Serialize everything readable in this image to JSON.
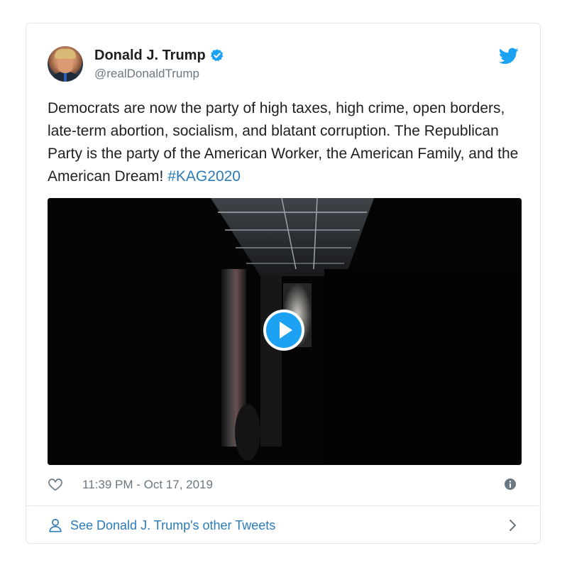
{
  "tweet": {
    "author_name": "Donald J. Trump",
    "handle": "@realDonaldTrump",
    "text": "Democrats are now the party of high taxes, high crime, open borders, late-term abortion, socialism, and blatant corruption. The Republican Party is the party of the American Worker, the American Family, and the American Dream!",
    "hashtag": "#KAG2020",
    "timestamp": "11:39 PM - Oct 17, 2019"
  },
  "footer": {
    "more_tweets_label": "See Donald J. Trump's other Tweets"
  },
  "icons": {
    "verified": "verified-badge-icon",
    "brand": "twitter-bird-icon",
    "play": "play-icon",
    "like": "heart-icon",
    "info": "info-icon",
    "profile": "person-icon",
    "chevron": "chevron-right-icon"
  },
  "colors": {
    "link": "#2b7bb9",
    "twitter_blue": "#1da1f2",
    "secondary_text": "#697882",
    "border": "#e1e8ed"
  }
}
